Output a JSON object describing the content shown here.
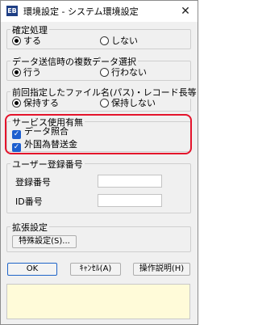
{
  "window": {
    "icon_text": "EB",
    "title": "環境設定 - システム環境設定",
    "close_glyph": "✕"
  },
  "groups": {
    "kakutei": {
      "title": "確定処理",
      "options": [
        {
          "label": "する",
          "selected": true
        },
        {
          "label": "しない",
          "selected": false
        }
      ]
    },
    "data_send": {
      "title": "データ送信時の複数データ選択",
      "options": [
        {
          "label": "行う",
          "selected": true
        },
        {
          "label": "行わない",
          "selected": false
        }
      ]
    },
    "prev_file": {
      "title": "前回指定したファイル名(パス)・レコード長等",
      "options": [
        {
          "label": "保持する",
          "selected": true
        },
        {
          "label": "保持しない",
          "selected": false
        }
      ]
    },
    "service": {
      "title": "サービス使用有無",
      "items": [
        {
          "label": "データ照合",
          "checked": true
        },
        {
          "label": "外国為替送金",
          "checked": true
        }
      ]
    },
    "user_reg": {
      "title": "ユーザー登録番号",
      "reg_no_label": "登録番号",
      "reg_no_value": "",
      "id_no_label": "ID番号",
      "id_no_value": ""
    },
    "extension": {
      "title": "拡張設定",
      "button_label": "特殊設定(S)..."
    }
  },
  "buttons": {
    "ok": "OK",
    "cancel": "ｷｬﾝｾﾙ(A)",
    "help": "操作説明(H)"
  },
  "message_area": "",
  "colors": {
    "highlight_border": "#e4132b",
    "checkbox_fill": "#1d5fcf",
    "message_bg": "#fffbd9",
    "window_bg": "#f0f0f0"
  }
}
